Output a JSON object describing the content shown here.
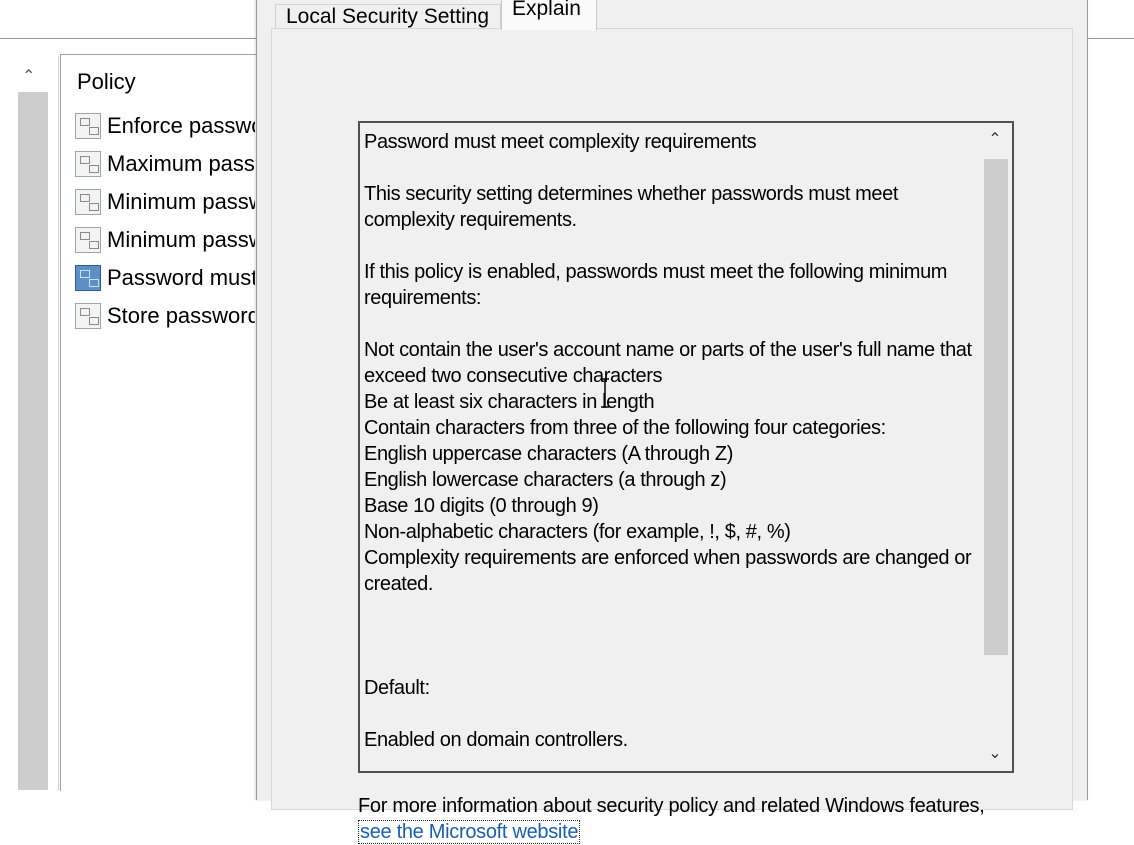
{
  "policy_pane": {
    "header": "Policy",
    "items": [
      {
        "label": "Enforce password history",
        "selected": false
      },
      {
        "label": "Maximum password age",
        "selected": false
      },
      {
        "label": "Minimum password age",
        "selected": false
      },
      {
        "label": "Minimum password length",
        "selected": false
      },
      {
        "label": "Password must meet complexity requirements",
        "selected": true
      },
      {
        "label": "Store passwords using reversible encryption",
        "selected": false
      }
    ]
  },
  "dialog": {
    "tabs": [
      {
        "label": "Local Security Setting",
        "active": false
      },
      {
        "label": "Explain",
        "active": true
      }
    ],
    "explain": {
      "title": "Password must meet complexity requirements",
      "p1": "This security setting determines whether passwords must meet complexity requirements.",
      "p2": "If this policy is enabled, passwords must meet the following minimum requirements:",
      "requirements": [
        "Not contain the user's account name or parts of the user's full name that exceed two consecutive characters",
        "Be at least six characters in length",
        "Contain characters from three of the following four categories:",
        "English uppercase characters (A through Z)",
        "English lowercase characters (a through z)",
        "Base 10 digits (0 through 9)",
        "Non-alphabetic characters (for example, !, $, #, %)",
        "Complexity requirements are enforced when passwords are changed or created."
      ],
      "default_label": "Default:",
      "default_value": "Enabled on domain controllers."
    },
    "more_info_prefix": "For more information about security policy and related Windows features, ",
    "more_info_link": "see the Microsoft website"
  },
  "icons": {
    "scroll_up": "chevron-up-icon",
    "scroll_down": "chevron-down-icon",
    "policy": "policy-icon"
  },
  "colors": {
    "dialog_bg": "#f0f0f0",
    "link": "#1a5fb4",
    "selected_icon": "#5a8fc8"
  }
}
